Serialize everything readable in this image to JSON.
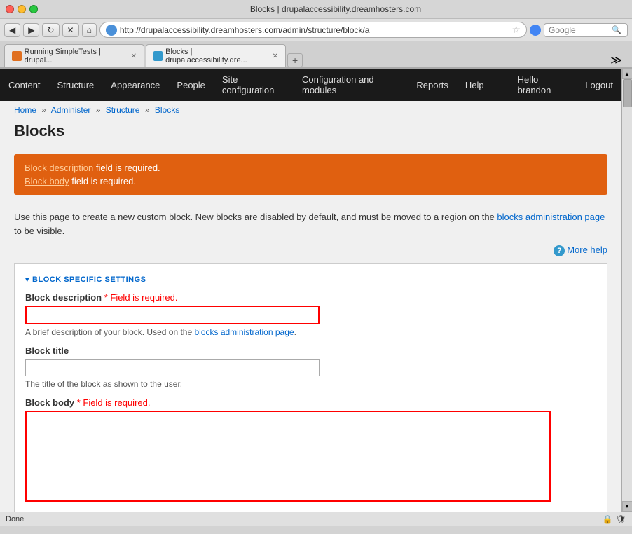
{
  "browser": {
    "title": "Blocks | drupalaccessibility.dreamhosters.com",
    "address": "http://drupalaccessibility.dreamhosters.com/admin/structure/block/a",
    "search_placeholder": "Google",
    "tab1_label": "Running SimpleTests | drupal...",
    "tab2_label": "Blocks | drupalaccessibility.dre...",
    "add_tab_label": "+"
  },
  "nav": {
    "content": "Content",
    "structure": "Structure",
    "appearance": "Appearance",
    "people": "People",
    "site_config": "Site configuration",
    "config_modules": "Configuration and modules",
    "reports": "Reports",
    "help": "Help",
    "user": "Hello brandon",
    "logout": "Logout"
  },
  "breadcrumb": {
    "home": "Home",
    "administer": "Administer",
    "structure": "Structure",
    "blocks": "Blocks"
  },
  "page": {
    "title": "Blocks",
    "description_part1": "Use this page to create a new custom block. New blocks are disabled by default, and must be moved to a region on the",
    "description_link": "blocks administration page",
    "description_part2": "to be visible.",
    "more_help": "More help"
  },
  "errors": {
    "error1_link": "Block description",
    "error1_text": " field is required.",
    "error2_link": "Block body",
    "error2_text": " field is required."
  },
  "form": {
    "section_toggle": "▾",
    "section_title": "BLOCK SPECIFIC SETTINGS",
    "block_description_label": "Block description",
    "block_description_required": "* Field is required.",
    "block_description_hint_part1": "A brief description of your block. Used on the",
    "block_description_hint_link": "blocks administration page",
    "block_description_hint_part2": ".",
    "block_title_label": "Block title",
    "block_title_hint": "The title of the block as shown to the user.",
    "block_body_label": "Block body",
    "block_body_required": "* Field is required."
  },
  "status_bar": {
    "text": "Done"
  }
}
